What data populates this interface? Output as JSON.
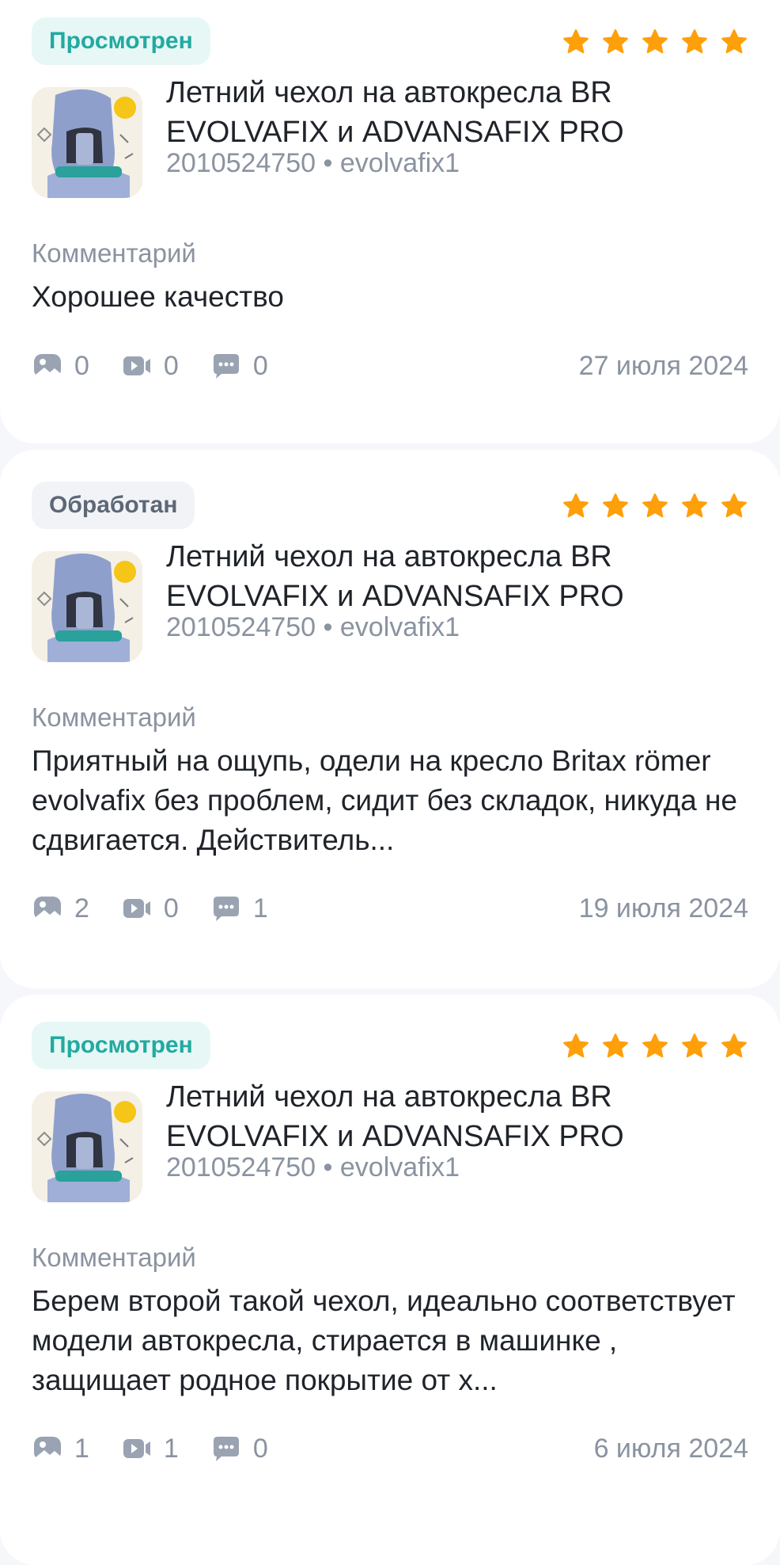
{
  "colors": {
    "star": "#ff9f0a",
    "viewed_text": "#22aaa0",
    "viewed_bg": "#e6f7f6",
    "processed_text": "#5d6776",
    "processed_bg": "#f1f3f7",
    "muted": "#8a93a0"
  },
  "reviews": [
    {
      "status": "Просмотрен",
      "status_type": "viewed",
      "rating": 5,
      "product": {
        "title": "Летний чехол на автокресла BR EVOLVAFIX и ADVANSAFIX PRO",
        "meta": "2010524750 • evolvafix1"
      },
      "comment_label": "Комментарий",
      "comment": "Хорошее качество",
      "stats": {
        "photos": "0",
        "videos": "0",
        "replies": "0"
      },
      "date": "27 июля 2024"
    },
    {
      "status": "Обработан",
      "status_type": "processed",
      "rating": 5,
      "product": {
        "title": "Летний чехол на автокресла BR EVOLVAFIX и ADVANSAFIX PRO",
        "meta": "2010524750 • evolvafix1"
      },
      "comment_label": "Комментарий",
      "comment": "Приятный на ощупь, одели на кресло Britax römer evolvafix без проблем, сидит без складок, никуда не сдвигается. Действитель...",
      "stats": {
        "photos": "2",
        "videos": "0",
        "replies": "1"
      },
      "date": "19 июля 2024"
    },
    {
      "status": "Просмотрен",
      "status_type": "viewed",
      "rating": 5,
      "product": {
        "title": "Летний чехол на автокресла BR EVOLVAFIX и ADVANSAFIX PRO",
        "meta": "2010524750 • evolvafix1"
      },
      "comment_label": "Комментарий",
      "comment": "Берем второй такой чехол, идеально соответствует модели автокресла, стирается в машинке , защищает родное покрытие от х...",
      "stats": {
        "photos": "1",
        "videos": "1",
        "replies": "0"
      },
      "date": "6 июля 2024"
    }
  ]
}
